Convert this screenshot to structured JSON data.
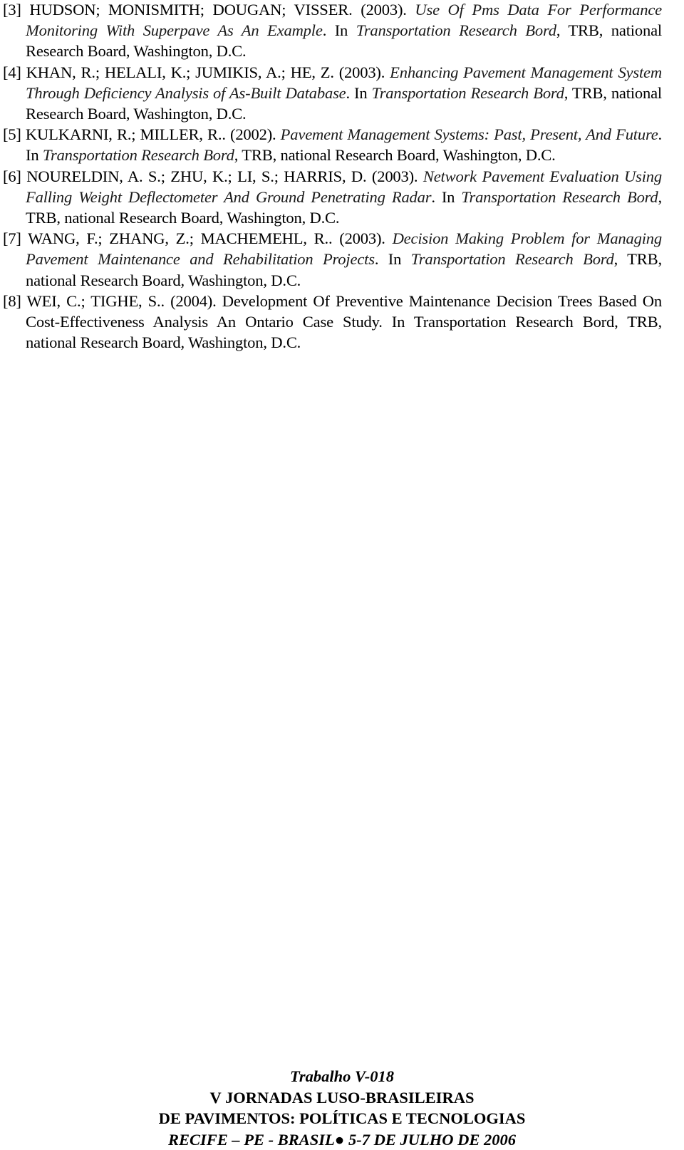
{
  "references": [
    {
      "num": "[3]",
      "authors": " HUDSON; MONISMITH; DOUGAN; VISSER. (2003). ",
      "title": "Use Of Pms Data For Performance Monitoring With Superpave As An Example",
      "in": ". In ",
      "venue": "Transportation Research Bord",
      "tail": ", TRB, national Research Board, Washington, D.C."
    },
    {
      "num": "[4]",
      "authors": " KHAN, R.; HELALI, K.; JUMIKIS, A.; HE, Z. (2003). ",
      "title": "Enhancing Pavement Management System Through Deficiency Analysis of As-Built Database",
      "in": ". In ",
      "venue": "Transportation Research Bord",
      "tail": ", TRB, national Research Board, Washington, D.C."
    },
    {
      "num": "[5]",
      "authors": " KULKARNI, R.; MILLER, R.. (2002). ",
      "title": "Pavement Management Systems: Past, Present, And Future",
      "in": ". In ",
      "venue": "Transportation Research Bord",
      "tail": ", TRB, national Research Board, Washington, D.C."
    },
    {
      "num": "[6]",
      "authors": " NOURELDIN, A. S.; ZHU, K.; LI, S.; HARRIS, D. (2003). ",
      "title": "Network Pavement Evaluation Using Falling Weight Deflectometer And Ground Penetrating Radar",
      "in": ". In ",
      "venue": "Transportation Research Bord",
      "tail": ", TRB, national Research Board, Washington, D.C."
    },
    {
      "num": "[7]",
      "authors": " WANG, F.; ZHANG, Z.; MACHEMEHL, R.. (2003). ",
      "title": "Decision Making Problem for Managing Pavement Maintenance and Rehabilitation Projects",
      "in": ". In ",
      "venue": "Transportation Research Bord",
      "tail": ", TRB, national Research Board, Washington, D.C."
    },
    {
      "num": "[8]",
      "authors": " WEI, C.; TIGHE, S.. (2004). ",
      "plain": "Development Of Preventive Maintenance Decision Trees Based On Cost-Effectiveness Analysis An Ontario Case Study. In Transportation Research Bord, TRB, national Research Board, Washington, D.C."
    }
  ],
  "footer": {
    "paper_id": "Trabalho V-018",
    "event_line1": "V JORNADAS LUSO-BRASILEIRAS",
    "event_line2": "DE PAVIMENTOS: POLÍTICAS E TECNOLOGIAS",
    "location_date": "RECIFE – PE - BRASIL● 5-7 DE JULHO DE 2006"
  }
}
